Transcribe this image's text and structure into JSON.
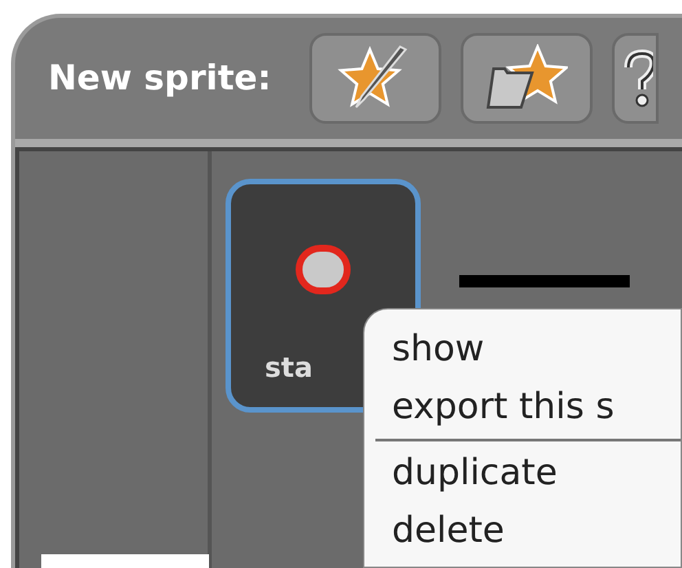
{
  "toolbar": {
    "label": "New sprite:",
    "buttons": [
      {
        "kind": "paint"
      },
      {
        "kind": "folder"
      },
      {
        "kind": "surprise"
      }
    ]
  },
  "sprites": [
    {
      "name": "sta",
      "selected": true
    }
  ],
  "context_menu": {
    "items": [
      {
        "kind": "item",
        "label": "show"
      },
      {
        "kind": "item",
        "label": "export this s"
      },
      {
        "kind": "separator"
      },
      {
        "kind": "item",
        "label": "duplicate"
      },
      {
        "kind": "item",
        "label": "delete"
      }
    ]
  }
}
